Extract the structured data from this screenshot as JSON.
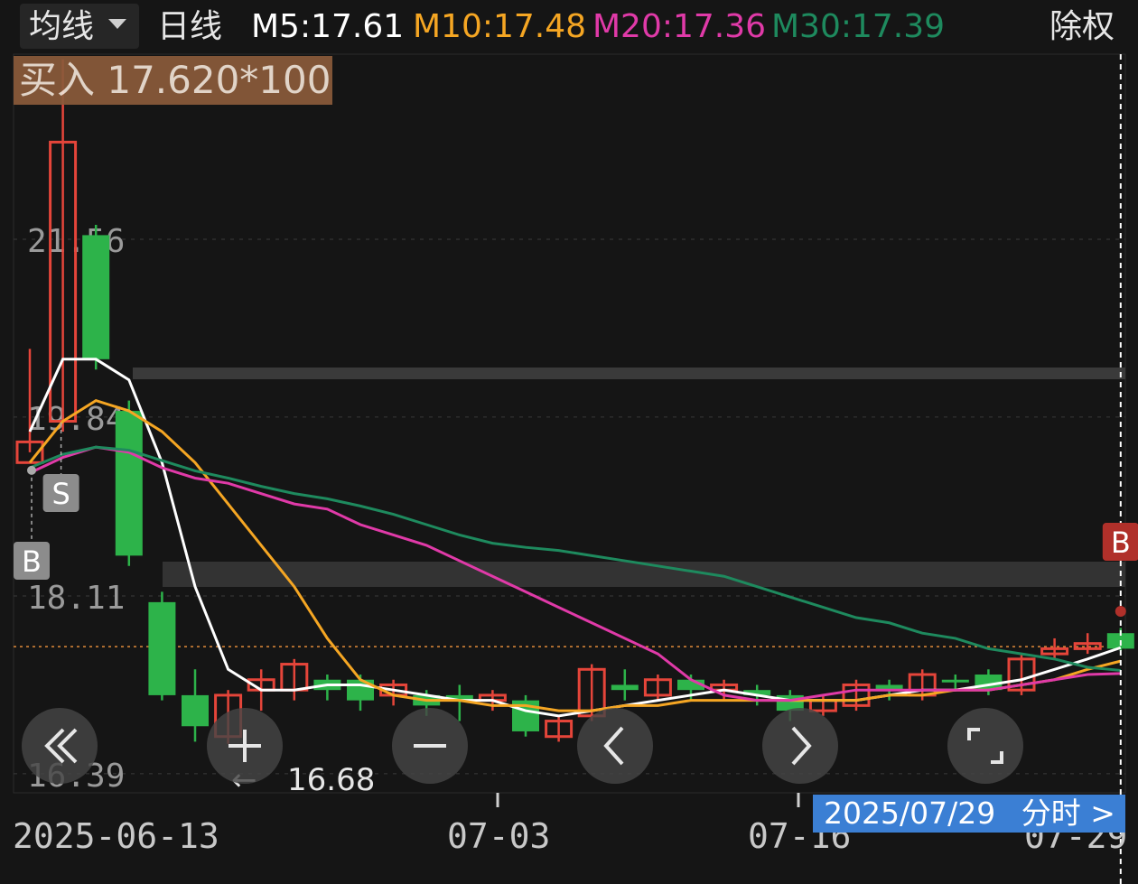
{
  "header": {
    "ma_selector_label": "均线",
    "period_label": "日线",
    "ma5": "M5:17.61",
    "ma10": "M10:17.48",
    "ma20": "M20:17.36",
    "ma30": "M30:17.39",
    "adjust_label": "除权"
  },
  "colors": {
    "up": "#e5453a",
    "down": "#2db34a",
    "ma5": "#ffffff",
    "ma10": "#f5a623",
    "ma20": "#e03aa8",
    "ma30": "#1e8a5e",
    "buy_marker": "#b0302a",
    "date_tag": "#3b7fd4"
  },
  "overlay": {
    "buy_order": "买入 17.620*100",
    "low_marker": "16.68",
    "date_tag": "2025/07/29",
    "timeshare_link": "分时 >"
  },
  "nav_buttons": [
    "rewind-icon",
    "zoom-in-icon",
    "zoom-out-icon",
    "prev-icon",
    "next-icon",
    "fullscreen-icon"
  ],
  "chart_data": {
    "type": "candlestick",
    "y_ticks": [
      "21.56",
      "19.84",
      "18.11",
      "16.39"
    ],
    "x_tick_labels": [
      "2025-06-13",
      "07-03",
      "07-16",
      "07-29"
    ],
    "ylim": [
      16.1,
      23.5
    ],
    "grid": true,
    "markers": [
      {
        "label": "B",
        "index": 0
      },
      {
        "label": "S",
        "index": 1
      },
      {
        "label": "B",
        "index": 33
      }
    ],
    "candles": [
      {
        "o": 19.6,
        "h": 20.5,
        "l": 19.5,
        "c": 19.4,
        "dir": "up"
      },
      {
        "o": 19.8,
        "h": 23.3,
        "l": 19.7,
        "c": 22.5,
        "dir": "up"
      },
      {
        "o": 21.6,
        "h": 21.7,
        "l": 20.3,
        "c": 20.4,
        "dir": "down"
      },
      {
        "o": 19.9,
        "h": 20.0,
        "l": 18.4,
        "c": 18.5,
        "dir": "down"
      },
      {
        "o": 18.05,
        "h": 18.15,
        "l": 17.1,
        "c": 17.15,
        "dir": "down"
      },
      {
        "o": 17.15,
        "h": 17.4,
        "l": 16.7,
        "c": 16.85,
        "dir": "down"
      },
      {
        "o": 16.75,
        "h": 17.2,
        "l": 16.68,
        "c": 17.15,
        "dir": "up"
      },
      {
        "o": 17.2,
        "h": 17.4,
        "l": 17.0,
        "c": 17.3,
        "dir": "up"
      },
      {
        "o": 17.2,
        "h": 17.5,
        "l": 17.1,
        "c": 17.45,
        "dir": "up"
      },
      {
        "o": 17.3,
        "h": 17.35,
        "l": 17.1,
        "c": 17.2,
        "dir": "down"
      },
      {
        "o": 17.3,
        "h": 17.35,
        "l": 17.0,
        "c": 17.1,
        "dir": "down"
      },
      {
        "o": 17.15,
        "h": 17.3,
        "l": 17.05,
        "c": 17.25,
        "dir": "up"
      },
      {
        "o": 17.15,
        "h": 17.2,
        "l": 16.95,
        "c": 17.05,
        "dir": "down"
      },
      {
        "o": 17.15,
        "h": 17.25,
        "l": 16.9,
        "c": 17.1,
        "dir": "down"
      },
      {
        "o": 17.1,
        "h": 17.2,
        "l": 17.0,
        "c": 17.15,
        "dir": "up"
      },
      {
        "o": 17.1,
        "h": 17.15,
        "l": 16.75,
        "c": 16.8,
        "dir": "down"
      },
      {
        "o": 16.75,
        "h": 16.95,
        "l": 16.7,
        "c": 16.9,
        "dir": "up"
      },
      {
        "o": 16.95,
        "h": 17.45,
        "l": 16.9,
        "c": 17.4,
        "dir": "up"
      },
      {
        "o": 17.25,
        "h": 17.4,
        "l": 17.1,
        "c": 17.2,
        "dir": "down"
      },
      {
        "o": 17.15,
        "h": 17.35,
        "l": 17.1,
        "c": 17.3,
        "dir": "up"
      },
      {
        "o": 17.3,
        "h": 17.35,
        "l": 17.1,
        "c": 17.2,
        "dir": "down"
      },
      {
        "o": 17.2,
        "h": 17.3,
        "l": 17.1,
        "c": 17.25,
        "dir": "up"
      },
      {
        "o": 17.2,
        "h": 17.25,
        "l": 17.05,
        "c": 17.15,
        "dir": "down"
      },
      {
        "o": 17.15,
        "h": 17.2,
        "l": 16.9,
        "c": 17.0,
        "dir": "down"
      },
      {
        "o": 17.0,
        "h": 17.15,
        "l": 16.95,
        "c": 17.1,
        "dir": "up"
      },
      {
        "o": 17.05,
        "h": 17.3,
        "l": 17.0,
        "c": 17.25,
        "dir": "up"
      },
      {
        "o": 17.2,
        "h": 17.3,
        "l": 17.1,
        "c": 17.25,
        "dir": "down"
      },
      {
        "o": 17.15,
        "h": 17.4,
        "l": 17.1,
        "c": 17.35,
        "dir": "up"
      },
      {
        "o": 17.3,
        "h": 17.35,
        "l": 17.2,
        "c": 17.3,
        "dir": "down"
      },
      {
        "o": 17.35,
        "h": 17.4,
        "l": 17.15,
        "c": 17.2,
        "dir": "down"
      },
      {
        "o": 17.2,
        "h": 17.55,
        "l": 17.15,
        "c": 17.5,
        "dir": "up"
      },
      {
        "o": 17.55,
        "h": 17.7,
        "l": 17.5,
        "c": 17.6,
        "dir": "up"
      },
      {
        "o": 17.6,
        "h": 17.75,
        "l": 17.55,
        "c": 17.65,
        "dir": "up"
      },
      {
        "o": 17.75,
        "h": 17.8,
        "l": 17.58,
        "c": 17.6,
        "dir": "down"
      }
    ],
    "series": [
      {
        "name": "M5",
        "values": [
          19.7,
          20.4,
          20.4,
          20.2,
          19.4,
          18.2,
          17.4,
          17.2,
          17.2,
          17.25,
          17.25,
          17.2,
          17.15,
          17.1,
          17.1,
          17.0,
          16.95,
          17.0,
          17.05,
          17.1,
          17.15,
          17.2,
          17.15,
          17.1,
          17.1,
          17.1,
          17.15,
          17.2,
          17.2,
          17.25,
          17.3,
          17.4,
          17.5,
          17.61
        ]
      },
      {
        "name": "M10",
        "values": [
          19.4,
          19.8,
          20.0,
          19.9,
          19.7,
          19.4,
          19.0,
          18.6,
          18.2,
          17.7,
          17.3,
          17.15,
          17.1,
          17.1,
          17.05,
          17.05,
          17.0,
          17.0,
          17.05,
          17.05,
          17.1,
          17.1,
          17.1,
          17.1,
          17.1,
          17.1,
          17.15,
          17.15,
          17.2,
          17.2,
          17.25,
          17.3,
          17.4,
          17.48
        ]
      },
      {
        "name": "M20",
        "values": [
          19.3,
          19.45,
          19.55,
          19.5,
          19.35,
          19.25,
          19.2,
          19.1,
          19.0,
          18.95,
          18.8,
          18.7,
          18.6,
          18.45,
          18.3,
          18.15,
          18.0,
          17.85,
          17.7,
          17.55,
          17.3,
          17.15,
          17.1,
          17.1,
          17.15,
          17.2,
          17.2,
          17.2,
          17.2,
          17.2,
          17.25,
          17.3,
          17.35,
          17.36
        ]
      },
      {
        "name": "M30",
        "values": [
          19.35,
          19.48,
          19.55,
          19.52,
          19.42,
          19.32,
          19.25,
          19.17,
          19.1,
          19.05,
          18.98,
          18.9,
          18.8,
          18.7,
          18.62,
          18.58,
          18.55,
          18.5,
          18.45,
          18.4,
          18.35,
          18.3,
          18.2,
          18.1,
          18.0,
          17.9,
          17.85,
          17.75,
          17.7,
          17.6,
          17.55,
          17.5,
          17.42,
          17.39
        ]
      }
    ]
  }
}
